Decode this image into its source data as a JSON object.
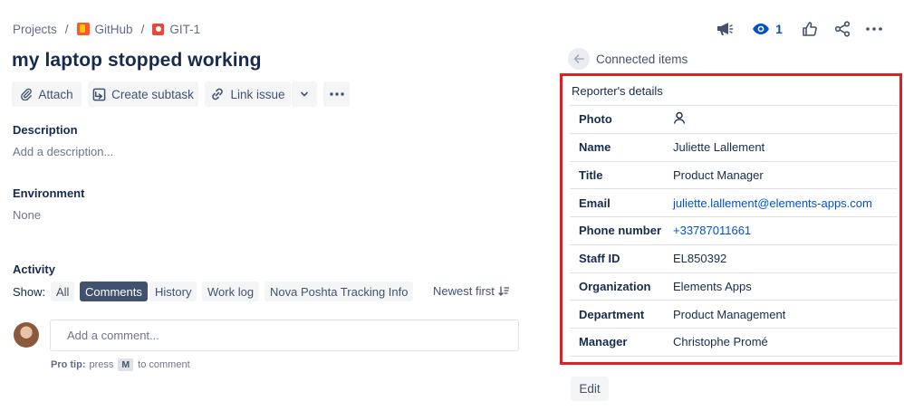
{
  "breadcrumb": {
    "projects": "Projects",
    "project": "GitHub",
    "issue_key": "GIT-1"
  },
  "issue": {
    "title": "my laptop stopped working"
  },
  "actions": {
    "attach": "Attach",
    "create_subtask": "Create subtask",
    "link_issue": "Link issue"
  },
  "description": {
    "label": "Description",
    "placeholder": "Add a description..."
  },
  "environment": {
    "label": "Environment",
    "value": "None"
  },
  "activity": {
    "label": "Activity",
    "show_label": "Show:",
    "filters": [
      "All",
      "Comments",
      "History",
      "Work log",
      "Nova Poshta Tracking Info"
    ],
    "active_filter": "Comments",
    "sort": "Newest first",
    "comment_placeholder": "Add a comment...",
    "pro_tip_label": "Pro tip:",
    "pro_tip_press": "press",
    "pro_tip_key": "M",
    "pro_tip_suffix": "to comment"
  },
  "header_actions": {
    "watchers_count": "1"
  },
  "connected_items": {
    "label": "Connected items"
  },
  "reporter_details": {
    "title": "Reporter's details",
    "rows": [
      {
        "key": "Photo",
        "value": ""
      },
      {
        "key": "Name",
        "value": "Juliette Lallement"
      },
      {
        "key": "Title",
        "value": "Product Manager"
      },
      {
        "key": "Email",
        "value": "juliette.lallement@elements-apps.com"
      },
      {
        "key": "Phone number",
        "value": "+33787011661"
      },
      {
        "key": "Staff ID",
        "value": "EL850392"
      },
      {
        "key": "Organization",
        "value": "Elements Apps"
      },
      {
        "key": "Department",
        "value": "Product Management"
      },
      {
        "key": "Manager",
        "value": "Christophe Promé"
      }
    ]
  },
  "edit_button": "Edit",
  "colors": {
    "text": "#172b4d",
    "muted": "#6b778c",
    "link": "#0052cc",
    "active_filter_bg": "#42526e",
    "button_bg": "#f4f5f7",
    "highlight_border": "#e31e24"
  },
  "icons": {
    "attach": "paperclip-icon",
    "subtask": "subtask-icon",
    "link": "link-icon",
    "announce": "megaphone-icon",
    "watch": "eye-icon",
    "like": "thumbs-up-icon",
    "share": "share-icon",
    "more": "more-icon",
    "back": "arrow-left-icon",
    "photo": "user-icon",
    "sort": "sort-icon"
  }
}
